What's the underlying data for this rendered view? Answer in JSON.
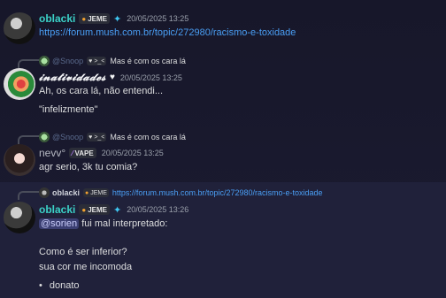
{
  "messages": [
    {
      "author": "oblacki",
      "tag": "JEME",
      "timestamp": "20/05/2025 13:25",
      "lines": [
        "https://forum.mush.com.br/topic/272980/racismo-e-toxidade"
      ]
    },
    {
      "reply": {
        "author": "@Snoop",
        "tag": ">_<",
        "text": "Mas é com os cara lá"
      },
      "author": "𝓲𝓷𝓪𝓽𝓲𝓿𝓲𝓭𝓪𝓭𝓮𝓼",
      "timestamp": "20/05/2025 13:25",
      "lines": [
        "Ah, os cara lá, não entendi...",
        "\"infelizmente\""
      ]
    },
    {
      "reply": {
        "author": "@Snoop",
        "tag": ">_<",
        "text": "Mas é com os cara lá"
      },
      "author": "nevv°",
      "tag": "VAPE",
      "timestamp": "20/05/2025 13:25",
      "lines": [
        "agr serio, 3k tu comia?"
      ]
    },
    {
      "reply": {
        "author": "oblacki",
        "tag": "JEME",
        "text": "https://forum.mush.com.br/topic/272980/racismo-e-toxidade"
      },
      "author": "oblacki",
      "tag": "JEME",
      "timestamp": "20/05/2025 13:26",
      "mention": "@sorien",
      "lines": [
        "fui mal interpretado:",
        "Como é ser inferior?",
        "sua cor me incomoda"
      ],
      "bullets": [
        "donato"
      ]
    }
  ],
  "icons": {
    "role_star": "star-icon",
    "jeme_emoji": "pig-face-icon",
    "vape_emoji": "vape-icon",
    "heart": "heart-icon"
  },
  "colors": {
    "background": "#1a1a2e",
    "link": "#4a9ff5",
    "username_oblacki": "#3bd1c7",
    "mention_bg": "#3b3f72"
  }
}
